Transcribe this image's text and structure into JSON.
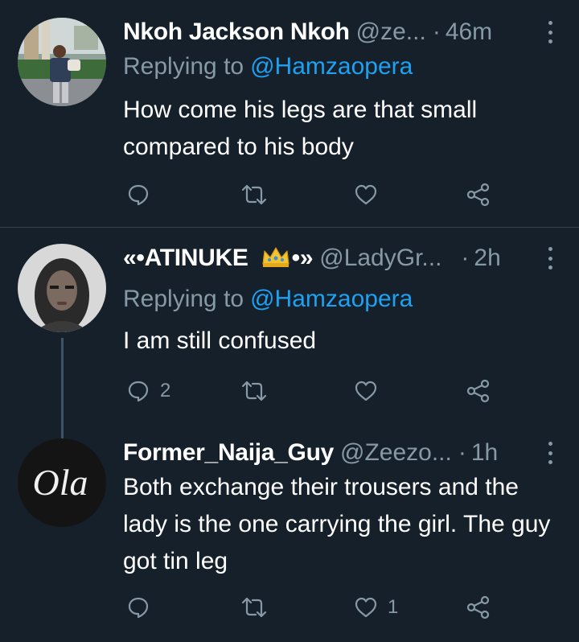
{
  "tweets": [
    {
      "name": "Nkoh Jackson Nkoh",
      "handle": "@ze...",
      "time": "46m",
      "replying_label": "Replying to",
      "replying_to": "@Hamzaopera",
      "text": "How come his legs are that small compared to his body",
      "reply_count": "",
      "like_count": ""
    },
    {
      "name": "«•ATINUKE",
      "name_suffix": "•»",
      "emoji": "crown",
      "handle": "@LadyGr...",
      "time": "2h",
      "replying_label": "Replying to",
      "replying_to": "@Hamzaopera",
      "text": "I am still confused",
      "reply_count": "2",
      "like_count": ""
    },
    {
      "name": "Former_Naija_Guy",
      "handle": "@Zeezo...",
      "time": "1h",
      "avatar_text": "Ola",
      "text": "Both exchange their trousers and the lady is the one carrying the girl. The guy got tin leg",
      "reply_count": "",
      "like_count": "1"
    }
  ],
  "colors": {
    "background": "#15202b",
    "name": "#ffffff",
    "muted": "#8899a6",
    "link": "#1da1f2",
    "divider": "#38444d"
  },
  "icons": [
    "reply-icon",
    "retweet-icon",
    "like-icon",
    "share-icon",
    "more-icon",
    "crown-emoji"
  ]
}
